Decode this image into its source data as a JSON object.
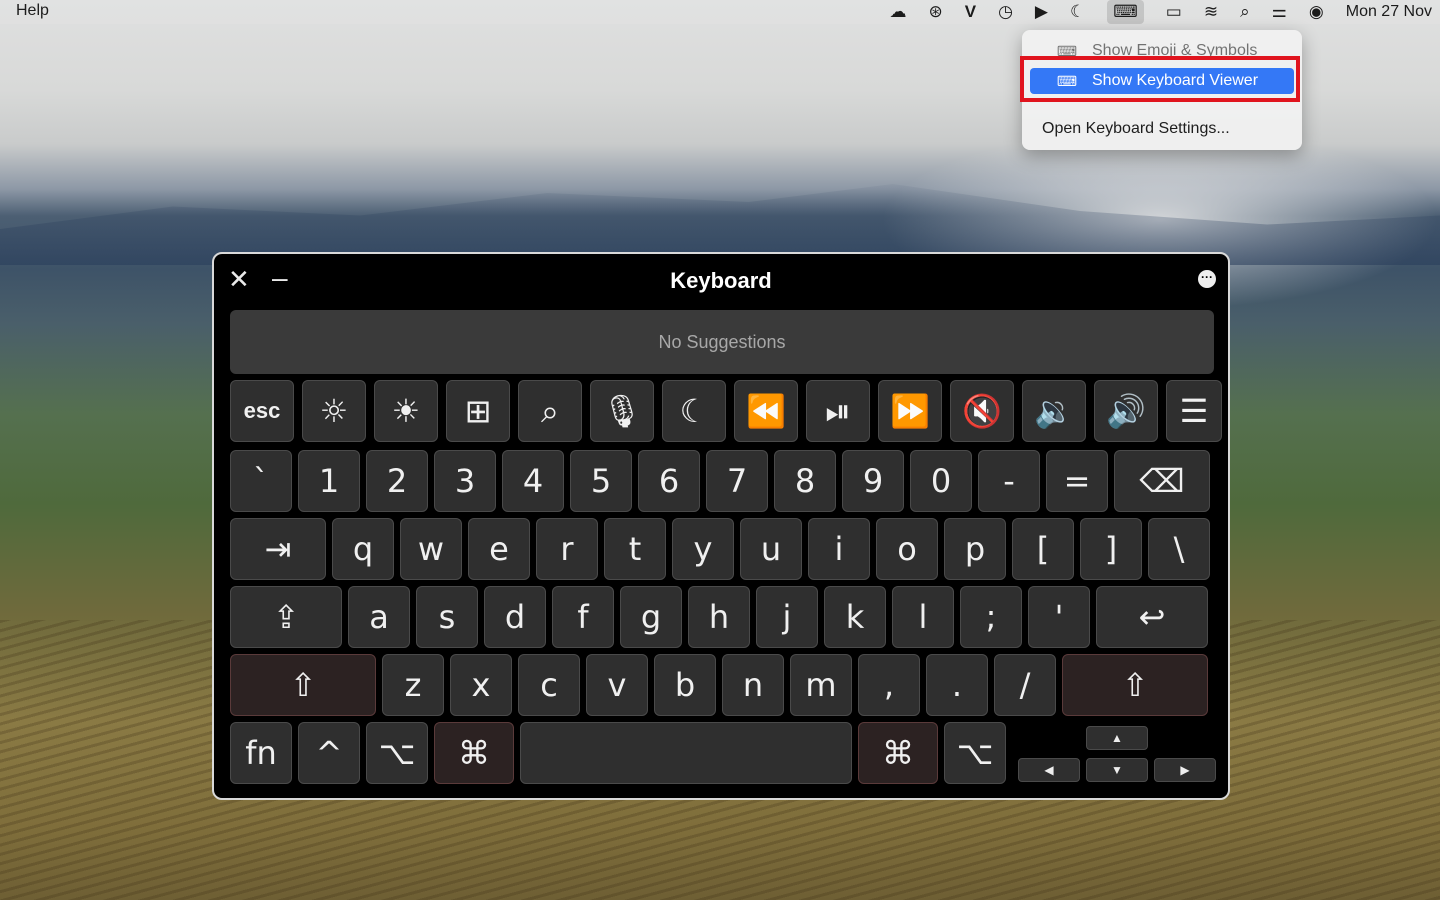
{
  "menubar": {
    "help_label": "Help",
    "status_icons": [
      "cloud-icon",
      "creative-cloud-icon",
      "vpn-icon",
      "time-machine-icon",
      "play-icon",
      "moon-icon",
      "keyboard-icon",
      "battery-icon",
      "wifi-icon",
      "search-icon",
      "control-center-icon",
      "siri-icon"
    ],
    "clock": "Mon 27 Nov"
  },
  "dropdown": {
    "item1": "Show Emoji & Symbols",
    "item2": "Show Keyboard Viewer",
    "item3": "Open Keyboard Settings..."
  },
  "keyboard": {
    "title": "Keyboard",
    "suggestions": "No Suggestions",
    "row_fn": [
      "esc",
      "☼",
      "☀",
      "⊞",
      "⌕",
      "🎙",
      "☾",
      "⏪",
      "⏯",
      "⏩",
      "🔇",
      "🔉",
      "🔊",
      "☰"
    ],
    "row_num": [
      "`",
      "1",
      "2",
      "3",
      "4",
      "5",
      "6",
      "7",
      "8",
      "9",
      "0",
      "-",
      "=",
      "⌫"
    ],
    "row_q": [
      "⇥",
      "q",
      "w",
      "e",
      "r",
      "t",
      "y",
      "u",
      "i",
      "o",
      "p",
      "[",
      "]",
      "\\"
    ],
    "row_a": [
      "⇪",
      "a",
      "s",
      "d",
      "f",
      "g",
      "h",
      "j",
      "k",
      "l",
      ";",
      "'",
      "↩"
    ],
    "row_z": [
      "⇧",
      "z",
      "x",
      "c",
      "v",
      "b",
      "n",
      "m",
      ",",
      ".",
      "/",
      "⇧"
    ],
    "row_bottom": [
      "fn",
      "^",
      "⌥",
      "⌘",
      "",
      "⌘",
      "⌥"
    ],
    "arrows": [
      "▲",
      "◀",
      "▼",
      "▶"
    ]
  },
  "colors": {
    "accent": "#3478f6",
    "highlight_box": "#e0141e"
  }
}
